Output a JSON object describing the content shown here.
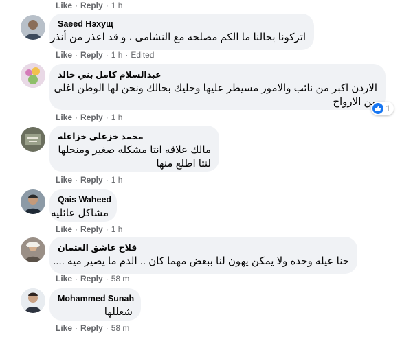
{
  "labels": {
    "like": "Like",
    "reply": "Reply",
    "edited": "Edited"
  },
  "colors": {
    "bubble": "#f0f2f5",
    "meta": "#65676b",
    "like_badge": "#1877f2"
  },
  "top_meta": {
    "time": "1 h"
  },
  "comments": [
    {
      "author": "Saeed Нэхущ",
      "text_lines": [
        "اتركونا بحالنا ما الكم مصلحه مع النشامى ، و قد اعذر من أنذر"
      ],
      "time": "1 h",
      "edited": true
    },
    {
      "author": "عبدالسلام كامل بني خالد",
      "text_lines": [
        "الاردن اكبر من نائب والامور مسيطر عليها وخليك بحالك ونحن لها الوطن اغلى",
        "من الارواح"
      ],
      "time": "1 h",
      "reaction": {
        "icon": "like-icon",
        "count": "1"
      }
    },
    {
      "author": "محمد خزعلي خزاعله",
      "text_lines": [
        "مالك علاقه انتا مشكله صغير ومنحلها",
        "لنتا اطلع منها"
      ],
      "time": "1 h"
    },
    {
      "author": "Qais Waheed",
      "text_lines": [
        "مشاكل عائليه"
      ],
      "time": "1 h"
    },
    {
      "author": "فلاح عاشق العثمان",
      "text_lines": [
        "حنا عيله وحده ولا يمكن يهون لنا ببعض مهما كان .. الدم ما يصير ميه ...."
      ],
      "time": "58 m"
    },
    {
      "author": "Mohammed Sunah",
      "text_lines": [
        "شعللها"
      ],
      "time": "58 m"
    }
  ]
}
